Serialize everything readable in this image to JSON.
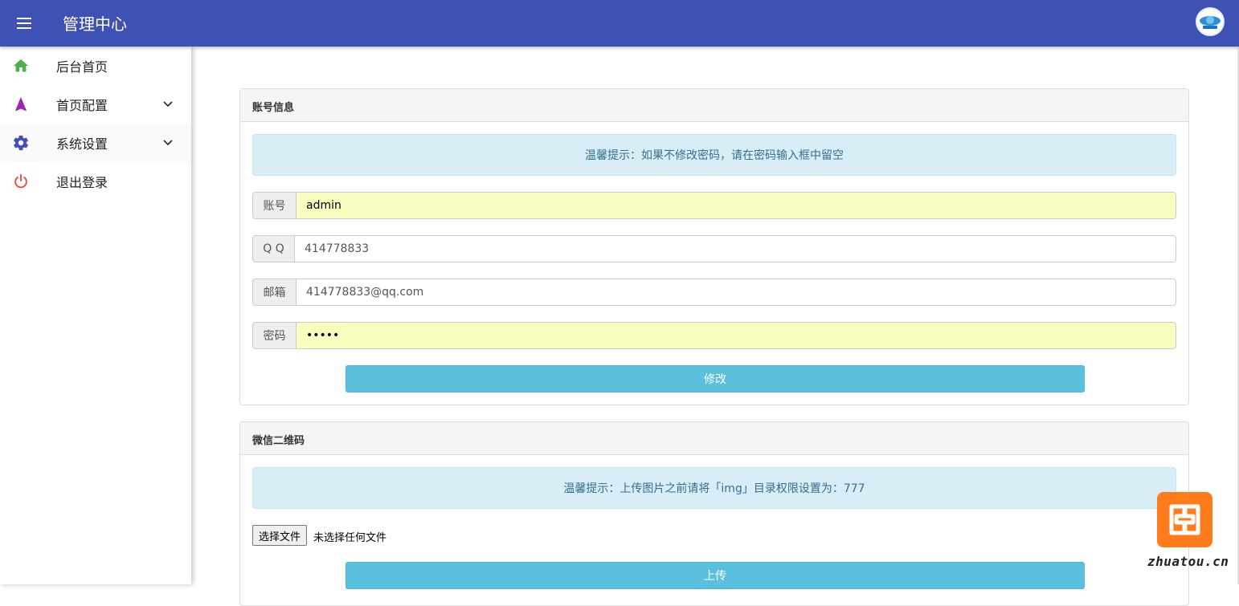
{
  "header": {
    "title": "管理中心",
    "menu_icon": "hamburger-menu-icon",
    "avatar_icon": "site-logo-avatar"
  },
  "sidebar": {
    "items": [
      {
        "label": "后台首页",
        "icon": "home-icon",
        "color": "#4caf50"
      },
      {
        "label": "首页配置",
        "icon": "navigation-arrow-icon",
        "color": "#9c27b0",
        "expandable": true
      },
      {
        "label": "系统设置",
        "icon": "gear-icon",
        "color": "#3f51b5",
        "expandable": true
      },
      {
        "label": "退出登录",
        "icon": "power-icon",
        "color": "#f44336"
      }
    ]
  },
  "account_panel": {
    "title": "账号信息",
    "notice": "温馨提示：如果不修改密码，请在密码输入框中留空",
    "fields": [
      {
        "label": "账号",
        "value": "admin"
      },
      {
        "label": "Q Q",
        "value": "414778833"
      },
      {
        "label": "邮箱",
        "value": "414778833@qq.com"
      },
      {
        "label": "密码",
        "value": "•••••"
      }
    ],
    "submit_label": "修改"
  },
  "wechat_panel": {
    "title": "微信二维码",
    "notice": "温馨提示：上传图片之前请将「img」目录权限设置为：777",
    "file_button_label": "选择文件",
    "file_status": "未选择任何文件",
    "upload_label": "上传"
  },
  "watermark": {
    "text": "zhuatou.cn"
  },
  "colors": {
    "header_bg": "#3f51b5",
    "button_info": "#5bc0de",
    "alert_bg": "#d9edf7",
    "autofill_bg": "#fafdc0"
  }
}
